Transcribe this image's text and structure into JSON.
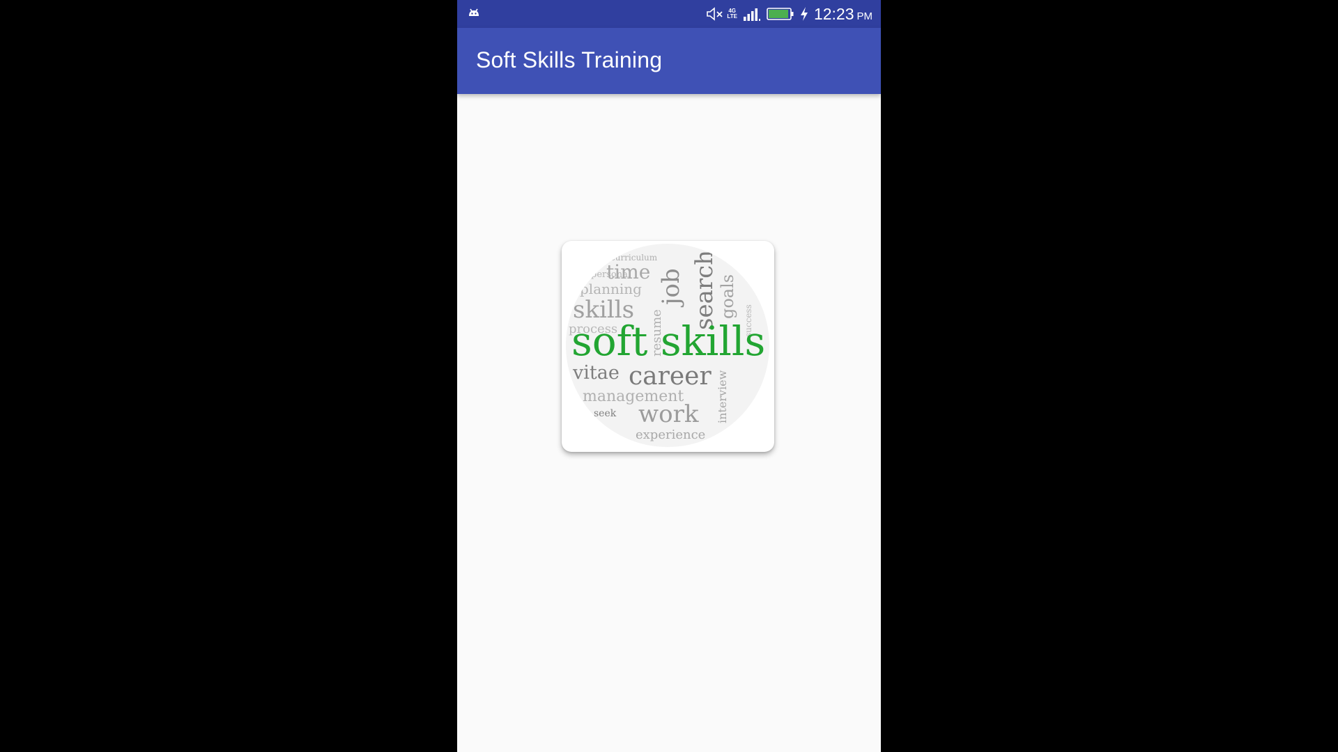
{
  "status_bar": {
    "network_lte_top": "4G",
    "network_lte_bottom": "LTE",
    "time": "12:23",
    "ampm": "PM",
    "icons": [
      "android-debug-icon",
      "mute-icon",
      "lte-icon",
      "signal-icon",
      "battery-icon",
      "charging-icon"
    ],
    "color": "#303f9f"
  },
  "app_bar": {
    "title": "Soft Skills Training",
    "color": "#3f51b5"
  },
  "word_cloud": {
    "main": "soft skills",
    "main_color": "#22a532",
    "words": [
      "time",
      "job",
      "search",
      "goals",
      "planning",
      "skills",
      "process",
      "resume",
      "vitae",
      "career",
      "management",
      "work",
      "seek",
      "experience",
      "interview",
      "curriculum",
      "personal",
      "success"
    ]
  }
}
